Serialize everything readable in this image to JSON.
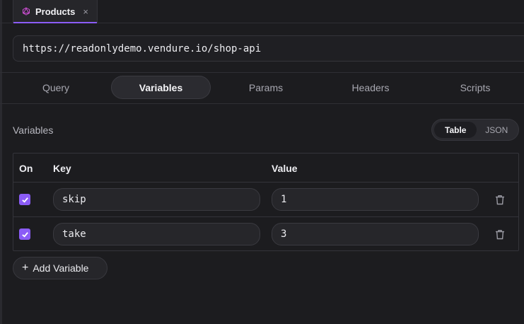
{
  "tab": {
    "label": "Products",
    "close": "×"
  },
  "url": {
    "value": "https://readonlydemo.vendure.io/shop-api"
  },
  "subtabs": [
    {
      "label": "Query"
    },
    {
      "label": "Variables"
    },
    {
      "label": "Params"
    },
    {
      "label": "Headers"
    },
    {
      "label": "Scripts"
    }
  ],
  "section": {
    "title": "Variables"
  },
  "format_toggle": {
    "table": "Table",
    "json": "JSON"
  },
  "table": {
    "headers": {
      "on": "On",
      "key": "Key",
      "value": "Value"
    },
    "rows": [
      {
        "on": true,
        "key": "skip",
        "value": "1"
      },
      {
        "on": true,
        "key": "take",
        "value": "3"
      }
    ]
  },
  "add_button": {
    "label": "Add Variable"
  },
  "colors": {
    "accent": "#8b5cf6",
    "background": "#1c1c1f"
  }
}
